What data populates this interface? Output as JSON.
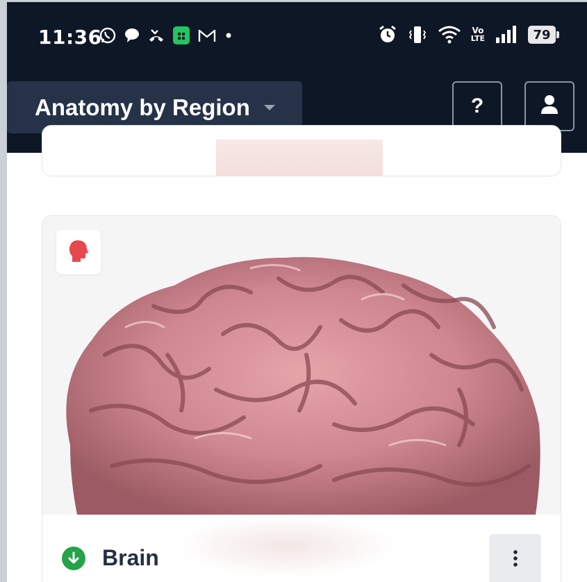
{
  "status_bar": {
    "time": "11:36",
    "left_icons": [
      "whatsapp-icon",
      "chat-bubble-icon",
      "missed-call-icon",
      "calculator-app-icon",
      "gmail-icon",
      "dot-icon"
    ],
    "right_icons": [
      "alarm-icon",
      "vibrate-icon",
      "wifi-icon",
      "volte-icon",
      "signal-icon"
    ],
    "volte_text_top": "Vo",
    "volte_text_bottom": "LTE",
    "battery": "79"
  },
  "header": {
    "region_selector": "Anatomy by Region",
    "help_label": "?"
  },
  "card": {
    "title": "Brain",
    "badge_icon": "head-icon",
    "status_icon": "download-icon",
    "menu_icon": "more-vertical-icon"
  },
  "colors": {
    "header_bg": "#0e1726",
    "dropdown_bg": "#253247",
    "accent_green": "#25a24a",
    "badge_red": "#e8474f",
    "title_text": "#243041"
  }
}
